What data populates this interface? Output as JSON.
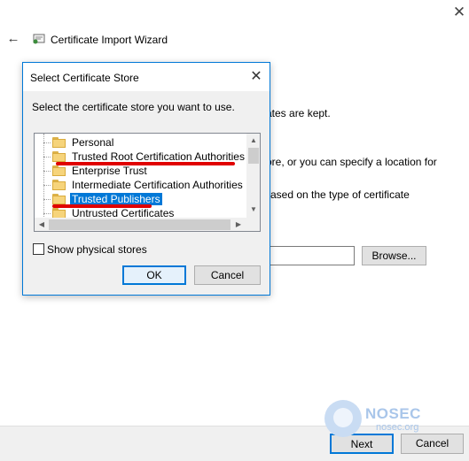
{
  "wizard": {
    "title": "Certificate Import Wizard",
    "close_glyph": "✕",
    "back_glyph": "←",
    "fragments": {
      "line1": "ates are kept.",
      "line2": "ore, or you can specify a location for",
      "line3": "ased on the type of certificate"
    },
    "browse_label": "Browse...",
    "next_label": "Next",
    "cancel_label": "Cancel"
  },
  "dialog": {
    "title": "Select Certificate Store",
    "close_glyph": "✕",
    "instruction": "Select the certificate store you want to use.",
    "stores": [
      {
        "label": "Personal",
        "selected": false
      },
      {
        "label": "Trusted Root Certification Authorities",
        "selected": false
      },
      {
        "label": "Enterprise Trust",
        "selected": false
      },
      {
        "label": "Intermediate Certification Authorities",
        "selected": false
      },
      {
        "label": "Trusted Publishers",
        "selected": true
      },
      {
        "label": "Untrusted Certificates",
        "selected": false
      }
    ],
    "show_physical_label": "Show physical stores",
    "show_physical_checked": false,
    "ok_label": "OK",
    "cancel_label": "Cancel",
    "scroll_glyphs": {
      "up": "▲",
      "down": "▼",
      "left": "◀",
      "right": "▶"
    }
  },
  "watermark": {
    "title": "NOSEC",
    "subtitle": "nosec.org"
  },
  "colors": {
    "accent": "#0078d7",
    "annotation_red": "#e00000",
    "watermark": "#a9c6ea"
  }
}
